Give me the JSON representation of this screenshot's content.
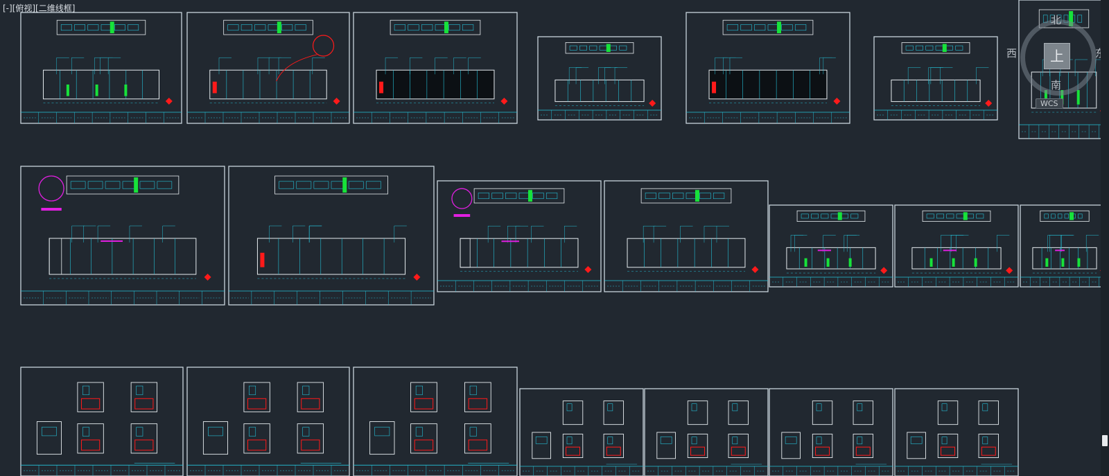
{
  "view_label": "[-][俯视][二维线框]",
  "viewcube": {
    "top_face": "上",
    "north": "北",
    "south": "南",
    "west": "西",
    "east": "东",
    "wcs": "WCS"
  },
  "colors": {
    "background": "#212830",
    "sheet_border": "#c8d4dc",
    "cad_cyan": "#25c2d9",
    "cad_red": "#ff1a1a",
    "cad_green": "#17e23a",
    "cad_magenta": "#e11fe1",
    "cad_white": "#e6ecef"
  },
  "sheets": [
    {
      "row": 1,
      "detail": "elev-wide"
    },
    {
      "row": 1,
      "detail": "elev-callout"
    },
    {
      "row": 1,
      "detail": "elev-dark"
    },
    {
      "row": 1,
      "detail": "elev-small"
    },
    {
      "row": 1,
      "detail": "elev-dark"
    },
    {
      "row": 1,
      "detail": "elev-small"
    },
    {
      "row": 1,
      "detail": "elev-partial"
    },
    {
      "row": 2,
      "detail": "plan-circle"
    },
    {
      "row": 2,
      "detail": "elev-wide-red"
    },
    {
      "row": 2,
      "detail": "plan-circle"
    },
    {
      "row": 2,
      "detail": "elev-small"
    },
    {
      "row": 2,
      "detail": "elev-booth"
    },
    {
      "row": 2,
      "detail": "elev-booth"
    },
    {
      "row": 2,
      "detail": "elev-booth"
    },
    {
      "row": 3,
      "detail": "rooms"
    },
    {
      "row": 3,
      "detail": "rooms"
    },
    {
      "row": 3,
      "detail": "rooms"
    },
    {
      "row": 3,
      "detail": "rooms-small"
    },
    {
      "row": 3,
      "detail": "rooms-small"
    },
    {
      "row": 3,
      "detail": "rooms-small"
    },
    {
      "row": 3,
      "detail": "rooms-small"
    }
  ]
}
